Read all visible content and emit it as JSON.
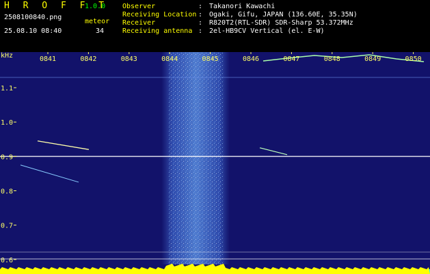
{
  "header": {
    "brand": "H R O F F T",
    "version": "1.0.0",
    "filename": "2508100840.png",
    "meteor_label": "meteor",
    "datetime": "25.08.10 08:40",
    "meteor_count": "34",
    "info": [
      {
        "label": "Observer",
        "value": "Takanori Kawachi"
      },
      {
        "label": "Receiving Location",
        "value": "Ogaki, Gifu, JAPAN (136.60E, 35.35N)"
      },
      {
        "label": "Receiver",
        "value": "R820T2(RTL-SDR) SDR-Sharp 53.372MHz"
      },
      {
        "label": "Receiving antenna",
        "value": "2el-HB9CV Vertical (el. E-W)"
      }
    ],
    "separator": ":"
  },
  "spectrogram": {
    "unit_label": "kHz",
    "y_ticks": [
      {
        "value": 1.1,
        "label": "1.1"
      },
      {
        "value": 1.0,
        "label": "1.0"
      },
      {
        "value": 0.9,
        "label": "0.9"
      },
      {
        "value": 0.8,
        "label": "0.8"
      },
      {
        "value": 0.7,
        "label": "0.7"
      },
      {
        "value": 0.6,
        "label": "0.6"
      }
    ],
    "time_ticks": [
      {
        "minute": 41,
        "label": "0841"
      },
      {
        "minute": 42,
        "label": "0842"
      },
      {
        "minute": 43,
        "label": "0843"
      },
      {
        "minute": 44,
        "label": "0844"
      },
      {
        "minute": 45,
        "label": "0845"
      },
      {
        "minute": 46,
        "label": "0846"
      },
      {
        "minute": 47,
        "label": "0847"
      },
      {
        "minute": 48,
        "label": "0848"
      },
      {
        "minute": 49,
        "label": "0849"
      },
      {
        "minute": 50,
        "label": "0850"
      }
    ],
    "colors": {
      "background": "#12126a",
      "noise_band": "#4a7ad0",
      "carrier": "#ffffff",
      "meteor_trail": "#ffffaa",
      "level_bar": "#ffff00",
      "level_base": "#00ffff"
    }
  }
}
